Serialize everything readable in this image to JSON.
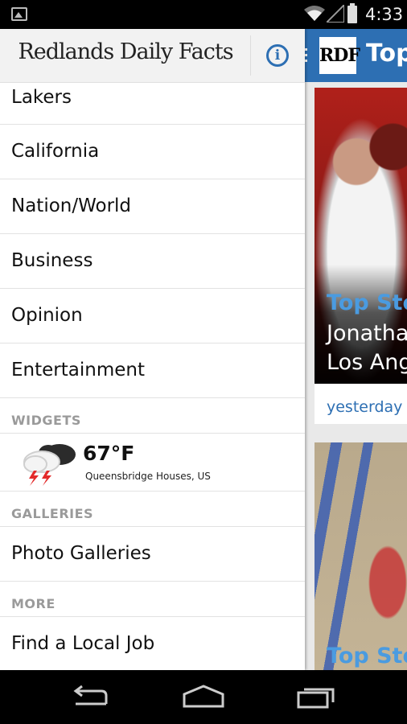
{
  "status_bar": {
    "time": "4:33"
  },
  "drawer": {
    "brand": "Redlands Daily Facts",
    "nav_items": [
      "Lakers",
      "California",
      "Nation/World",
      "Business",
      "Opinion",
      "Entertainment"
    ],
    "sections": {
      "widgets": "WIDGETS",
      "galleries": "GALLERIES",
      "more": "MORE"
    },
    "weather": {
      "temperature": "67°F",
      "location": "Queensbridge Houses, US",
      "icon": "thunderstorm-icon"
    },
    "galleries_item": "Photo Galleries",
    "more_item": "Find a Local Job"
  },
  "content": {
    "logo": "RDF",
    "title": "Top",
    "cards": [
      {
        "section": "Top Sto",
        "headline_lines": [
          "Jonatha",
          "Los Ang"
        ],
        "time": "yesterday"
      },
      {
        "section": "Top Sto"
      }
    ]
  },
  "colors": {
    "accent": "#2d6fb3",
    "section_blue": "#4a9be0"
  }
}
